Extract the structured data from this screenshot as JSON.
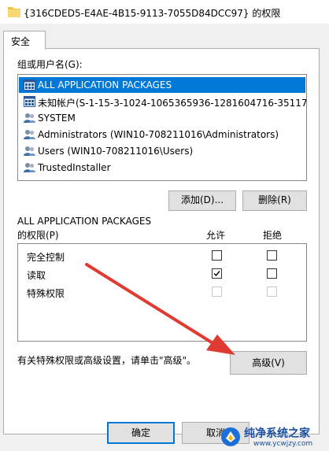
{
  "window": {
    "title": "{316CDED5-E4AE-4B15-9113-7055D84DCC97} 的权限"
  },
  "tabs": [
    {
      "label": "安全"
    }
  ],
  "users": {
    "label": "组或用户名(G):",
    "items": [
      {
        "label": "ALL APPLICATION PACKAGES",
        "icon": "app-packages-icon",
        "selected": true
      },
      {
        "label": "未知帐户(S-1-15-3-1024-1065365936-1281604716-351173…",
        "icon": "unknown-account-icon",
        "selected": false
      },
      {
        "label": "SYSTEM",
        "icon": "users-icon",
        "selected": false
      },
      {
        "label": "Administrators (WIN10-708211016\\Administrators)",
        "icon": "users-icon",
        "selected": false
      },
      {
        "label": "Users (WIN10-708211016\\Users)",
        "icon": "users-icon",
        "selected": false
      },
      {
        "label": "TrustedInstaller",
        "icon": "users-icon",
        "selected": false
      }
    ],
    "add_label": "添加(D)...",
    "remove_label": "删除(R)"
  },
  "permissions": {
    "for_line1": "ALL APPLICATION PACKAGES",
    "for_line2": "的权限(P)",
    "allow_header": "允许",
    "deny_header": "拒绝",
    "rows": [
      {
        "label": "完全控制",
        "allow": false,
        "deny": false,
        "enabled": true
      },
      {
        "label": "读取",
        "allow": true,
        "deny": false,
        "enabled": true
      },
      {
        "label": "特殊权限",
        "allow": false,
        "deny": false,
        "enabled": false
      }
    ]
  },
  "advanced": {
    "note": "有关特殊权限或高级设置，请单击\"高级\"。",
    "button_label": "高级(V)"
  },
  "footer": {
    "ok_label": "确定",
    "cancel_label": "取消"
  },
  "watermark": {
    "brand": "纯净系统之家",
    "url": "www.ycwjzy.com"
  },
  "colors": {
    "selection": "#0078d7",
    "arrow": "#e03b32"
  }
}
